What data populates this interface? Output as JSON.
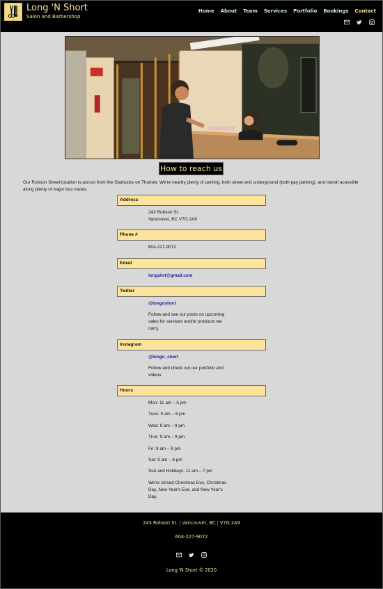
{
  "brand": {
    "name": "Long 'N Short",
    "tagline": "Salon and Barbershop",
    "logo_icon": "scissors-comb-icon"
  },
  "nav": {
    "items": [
      {
        "label": "Home",
        "active": false
      },
      {
        "label": "About",
        "active": false
      },
      {
        "label": "Team",
        "active": false
      },
      {
        "label": "Services",
        "active": false
      },
      {
        "label": "Portfolio",
        "active": false
      },
      {
        "label": "Bookings",
        "active": false
      },
      {
        "label": "Contact",
        "active": true
      }
    ]
  },
  "social_icons": [
    "email-icon",
    "twitter-icon",
    "instagram-icon"
  ],
  "hero": {
    "alt": "Salon reception desk with customer and receptionist"
  },
  "section": {
    "title": "How to reach us",
    "intro": "Our Robson Street location is across from the Starbucks on Thurlow. We're nearby plenty of parking, both street and underground (both pay parking), and transit acessible along plenty of major bus routes."
  },
  "info": {
    "address": {
      "heading": "Address",
      "line1": "243 Robson St.",
      "line2": "Vancouver, BC V7G 2A9"
    },
    "phone": {
      "heading": "Phone #",
      "value": "604-227-9072"
    },
    "email": {
      "heading": "Email",
      "value": "longshrt@gmail.com"
    },
    "twitter": {
      "heading": "Twitter",
      "handle": "@longnshort",
      "text": "Follow and see our posts on upcoming sales for services and/or products we carry."
    },
    "instagram": {
      "heading": "Instagram",
      "handle": "@longn_short",
      "text": "Follow and check out our portfolio and videos."
    },
    "hours": {
      "heading": "Hours",
      "lines": [
        "Mon: 11 am – 5 pm",
        "Tues: 9 am – 6 pm",
        "Wed: 9 am – 9 pm",
        "Thur: 9 am – 9 pm",
        "Fri: 9 am – 9 pm",
        "Sat: 9 am – 6 pm",
        "Sun and Holidays: 11 am – 7 pm"
      ],
      "note": "We're closed Christmas Eve, Christmas Day, New Year's Eve, and New Year's Day."
    }
  },
  "footer": {
    "street": "243 Robson St.",
    "city": "Vancouver, BC",
    "postal": "V7G 2A9",
    "separator": "|",
    "phone": "604-227-9072",
    "copyright": "Long 'N Short © 2020"
  },
  "colors": {
    "accent": "#f6e49c",
    "header_bg": "#000000",
    "page_bg": "#d8d8d8",
    "info_head_bg": "#fce49c",
    "link": "#1a1a9c",
    "nav_text": "#cfe9f0"
  }
}
